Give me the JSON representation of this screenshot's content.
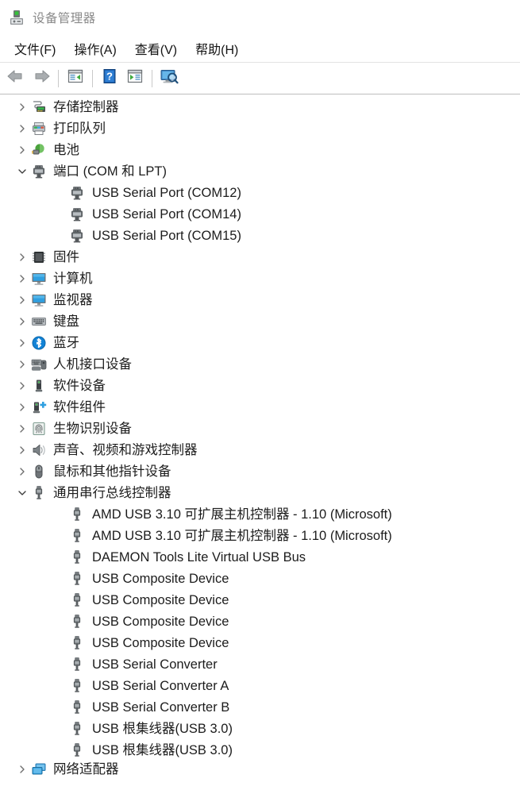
{
  "window": {
    "title": "设备管理器",
    "title_icon": "device-manager-icon"
  },
  "menubar": {
    "items": [
      {
        "label": "文件(F)",
        "name": "menu-file"
      },
      {
        "label": "操作(A)",
        "name": "menu-action"
      },
      {
        "label": "查看(V)",
        "name": "menu-view"
      },
      {
        "label": "帮助(H)",
        "name": "menu-help"
      }
    ]
  },
  "toolbar": {
    "buttons": [
      {
        "icon": "back-arrow-icon",
        "name": "toolbar-back"
      },
      {
        "icon": "forward-arrow-icon",
        "name": "toolbar-forward"
      },
      {
        "icon": "properties-icon",
        "name": "toolbar-properties"
      },
      {
        "icon": "help-icon",
        "name": "toolbar-help"
      },
      {
        "icon": "update-driver-icon",
        "name": "toolbar-update-driver"
      },
      {
        "icon": "scan-hardware-icon",
        "name": "toolbar-scan-hardware"
      }
    ]
  },
  "tree": {
    "rows": [
      {
        "label": "存储控制器",
        "depth": 1,
        "expander": "collapsed",
        "icon": "storage-controller-icon"
      },
      {
        "label": "打印队列",
        "depth": 1,
        "expander": "collapsed",
        "icon": "print-queue-icon"
      },
      {
        "label": "电池",
        "depth": 1,
        "expander": "collapsed",
        "icon": "battery-icon"
      },
      {
        "label": "端口 (COM 和 LPT)",
        "depth": 1,
        "expander": "expanded",
        "icon": "port-icon"
      },
      {
        "label": "USB Serial Port (COM12)",
        "depth": 2,
        "expander": "none",
        "icon": "port-icon"
      },
      {
        "label": "USB Serial Port (COM14)",
        "depth": 2,
        "expander": "none",
        "icon": "port-icon"
      },
      {
        "label": "USB Serial Port (COM15)",
        "depth": 2,
        "expander": "none",
        "icon": "port-icon"
      },
      {
        "label": "固件",
        "depth": 1,
        "expander": "collapsed",
        "icon": "firmware-icon"
      },
      {
        "label": "计算机",
        "depth": 1,
        "expander": "collapsed",
        "icon": "computer-icon"
      },
      {
        "label": "监视器",
        "depth": 1,
        "expander": "collapsed",
        "icon": "monitor-icon"
      },
      {
        "label": "键盘",
        "depth": 1,
        "expander": "collapsed",
        "icon": "keyboard-icon"
      },
      {
        "label": "蓝牙",
        "depth": 1,
        "expander": "collapsed",
        "icon": "bluetooth-icon"
      },
      {
        "label": "人机接口设备",
        "depth": 1,
        "expander": "collapsed",
        "icon": "hid-icon"
      },
      {
        "label": "软件设备",
        "depth": 1,
        "expander": "collapsed",
        "icon": "software-device-icon"
      },
      {
        "label": "软件组件",
        "depth": 1,
        "expander": "collapsed",
        "icon": "software-component-icon"
      },
      {
        "label": "生物识别设备",
        "depth": 1,
        "expander": "collapsed",
        "icon": "biometric-icon"
      },
      {
        "label": "声音、视频和游戏控制器",
        "depth": 1,
        "expander": "collapsed",
        "icon": "sound-icon"
      },
      {
        "label": "鼠标和其他指针设备",
        "depth": 1,
        "expander": "collapsed",
        "icon": "mouse-icon"
      },
      {
        "label": "通用串行总线控制器",
        "depth": 1,
        "expander": "expanded",
        "icon": "usb-icon"
      },
      {
        "label": "AMD USB 3.10 可扩展主机控制器 - 1.10 (Microsoft)",
        "depth": 2,
        "expander": "none",
        "icon": "usb-icon"
      },
      {
        "label": "AMD USB 3.10 可扩展主机控制器 - 1.10 (Microsoft)",
        "depth": 2,
        "expander": "none",
        "icon": "usb-icon"
      },
      {
        "label": "DAEMON Tools Lite Virtual USB Bus",
        "depth": 2,
        "expander": "none",
        "icon": "usb-icon"
      },
      {
        "label": "USB Composite Device",
        "depth": 2,
        "expander": "none",
        "icon": "usb-icon"
      },
      {
        "label": "USB Composite Device",
        "depth": 2,
        "expander": "none",
        "icon": "usb-icon"
      },
      {
        "label": "USB Composite Device",
        "depth": 2,
        "expander": "none",
        "icon": "usb-icon"
      },
      {
        "label": "USB Composite Device",
        "depth": 2,
        "expander": "none",
        "icon": "usb-icon"
      },
      {
        "label": "USB Serial Converter",
        "depth": 2,
        "expander": "none",
        "icon": "usb-icon"
      },
      {
        "label": "USB Serial Converter A",
        "depth": 2,
        "expander": "none",
        "icon": "usb-icon"
      },
      {
        "label": "USB Serial Converter B",
        "depth": 2,
        "expander": "none",
        "icon": "usb-icon"
      },
      {
        "label": "USB 根集线器(USB 3.0)",
        "depth": 2,
        "expander": "none",
        "icon": "usb-icon"
      },
      {
        "label": "USB 根集线器(USB 3.0)",
        "depth": 2,
        "expander": "none",
        "icon": "usb-icon"
      },
      {
        "label": "网络适配器",
        "depth": 1,
        "expander": "collapsed",
        "icon": "network-adapter-icon"
      }
    ]
  },
  "colors": {
    "background": "#ffffff",
    "text": "#1c1c1c",
    "title_text": "#8a8a8a",
    "chevron": "#6d6d6d",
    "accent_blue": "#3aa0e0",
    "toolbar_border": "#bdbdbd"
  }
}
